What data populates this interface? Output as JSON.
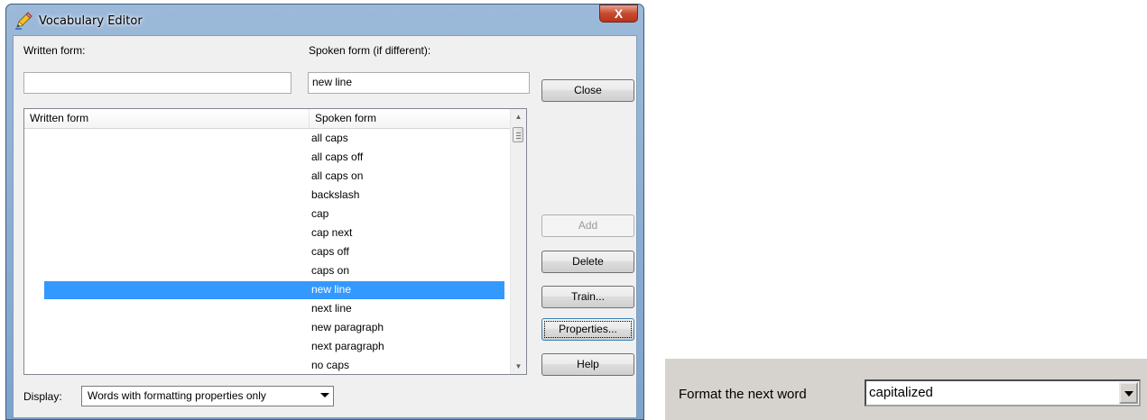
{
  "window": {
    "title": "Vocabulary Editor",
    "close_glyph": "X"
  },
  "fields": {
    "written_label": "Written form:",
    "written_value": "",
    "spoken_label": "Spoken form (if different):",
    "spoken_value": "new line"
  },
  "list": {
    "columns": [
      "Written form",
      "Spoken form"
    ],
    "rows": [
      {
        "written": "",
        "spoken": "all caps"
      },
      {
        "written": "",
        "spoken": "all caps off"
      },
      {
        "written": "",
        "spoken": "all caps on"
      },
      {
        "written": "",
        "spoken": "backslash"
      },
      {
        "written": "",
        "spoken": "cap"
      },
      {
        "written": "",
        "spoken": "cap next"
      },
      {
        "written": "",
        "spoken": "caps off"
      },
      {
        "written": "",
        "spoken": "caps on"
      },
      {
        "written": "",
        "spoken": "new line"
      },
      {
        "written": "",
        "spoken": "next line"
      },
      {
        "written": "",
        "spoken": "new paragraph"
      },
      {
        "written": "",
        "spoken": "next paragraph"
      },
      {
        "written": "",
        "spoken": "no caps"
      }
    ],
    "selected_spoken": "new line"
  },
  "buttons": {
    "close": "Close",
    "add": "Add",
    "delete": "Delete",
    "train": "Train...",
    "properties": "Properties...",
    "help": "Help"
  },
  "display": {
    "label": "Display:",
    "selected": "Words with formatting properties only"
  },
  "format_panel": {
    "label": "Format the next word",
    "selected": "capitalized"
  },
  "icons": {
    "title_icon": "pencil-icon",
    "scroll_up": "scroll-up-arrow-icon",
    "scroll_down": "scroll-down-arrow-icon",
    "dropdown": "chevron-down-icon"
  },
  "colors": {
    "selection": "#3399ff",
    "title_gradient_top": "#9cb9d9",
    "close_button": "#c74a2f"
  }
}
